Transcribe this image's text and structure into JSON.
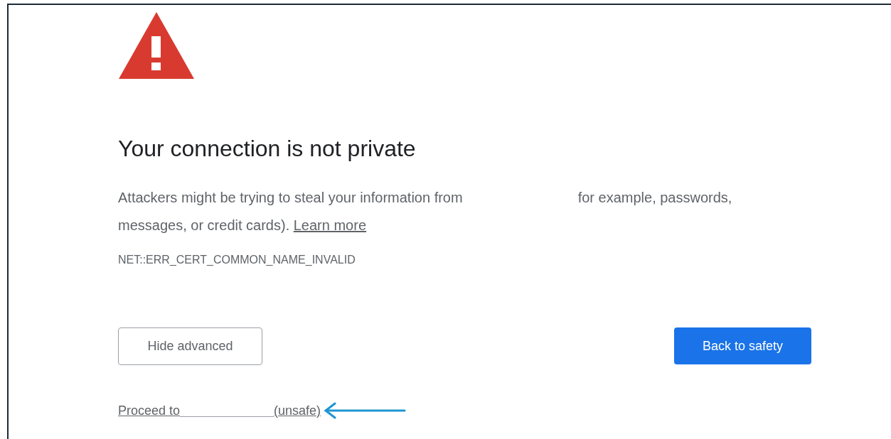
{
  "heading": "Your connection is not private",
  "message": {
    "before": "Attackers might be trying to steal your information from",
    "after": "for example, passwords, messages, or credit cards).",
    "link": "Learn more"
  },
  "error_code": "NET::ERR_CERT_COMMON_NAME_INVALID",
  "buttons": [
    {
      "label": "Hide advanced",
      "kind": "secondary"
    },
    {
      "label": "Back to safety",
      "kind": "primary"
    }
  ],
  "proceed_link": {
    "before": "Proceed to",
    "after": "(unsafe)"
  }
}
